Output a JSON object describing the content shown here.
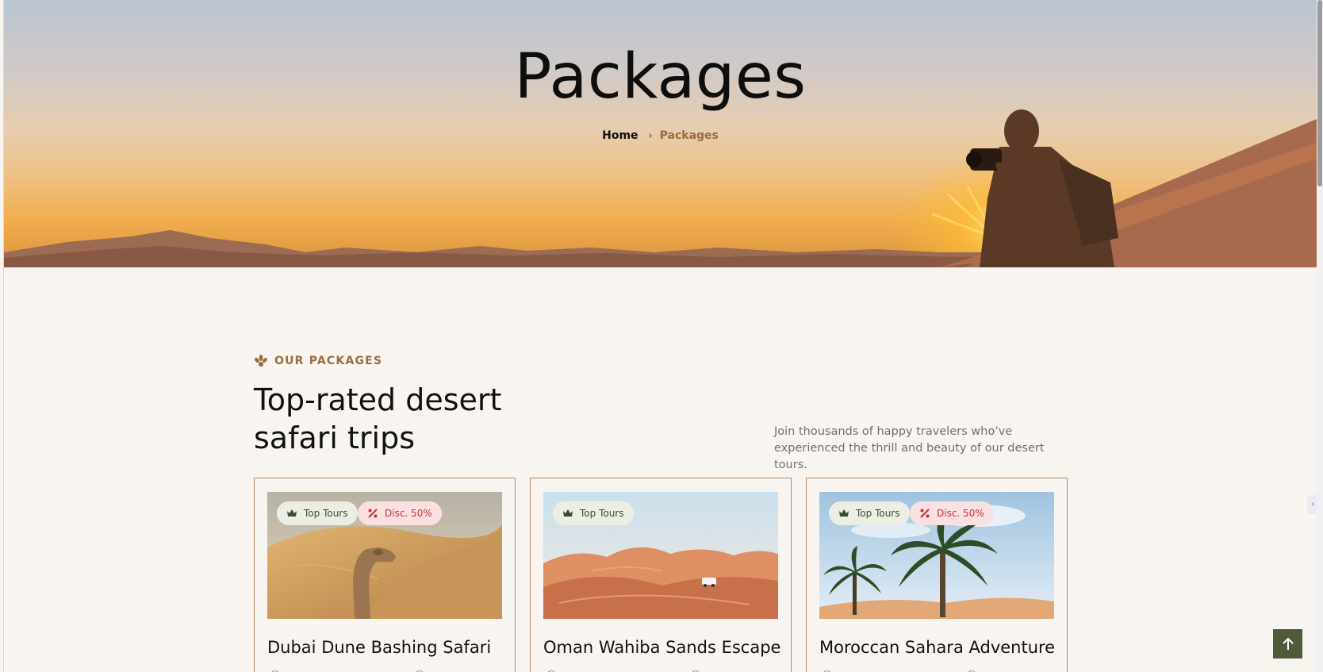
{
  "hero": {
    "title": "Packages",
    "breadcrumb": {
      "home": "Home",
      "separator": "›",
      "current": "Packages"
    }
  },
  "section": {
    "eyebrow": "OUR PACKAGES",
    "title": "Top-rated desert safari trips",
    "description": "Join thousands of happy travelers who’ve experienced the thrill and beauty of our desert tours."
  },
  "cards": [
    {
      "title": "Dubai Dune Bashing Safari",
      "badge_top": "Top Tours",
      "badge_discount": "Disc. 50%",
      "image": "camel-dunes-photo"
    },
    {
      "title": "Oman Wahiba Sands Escape",
      "badge_top": "Top Tours",
      "image": "red-dunes-jeep-photo"
    },
    {
      "title": "Moroccan Sahara Adventure",
      "badge_top": "Top Tours",
      "badge_discount": "Disc. 50%",
      "image": "palm-trees-photo"
    }
  ],
  "colors": {
    "accent": "#9a6c3f",
    "card_border": "#b58a63",
    "back_to_top": "#4f5a3a",
    "page_bg": "#f8f5f0"
  },
  "icons": {
    "top_badge": "crown-icon",
    "discount_badge": "percent-icon",
    "eyebrow": "lotus-icon",
    "back_to_top": "arrow-up-icon"
  }
}
